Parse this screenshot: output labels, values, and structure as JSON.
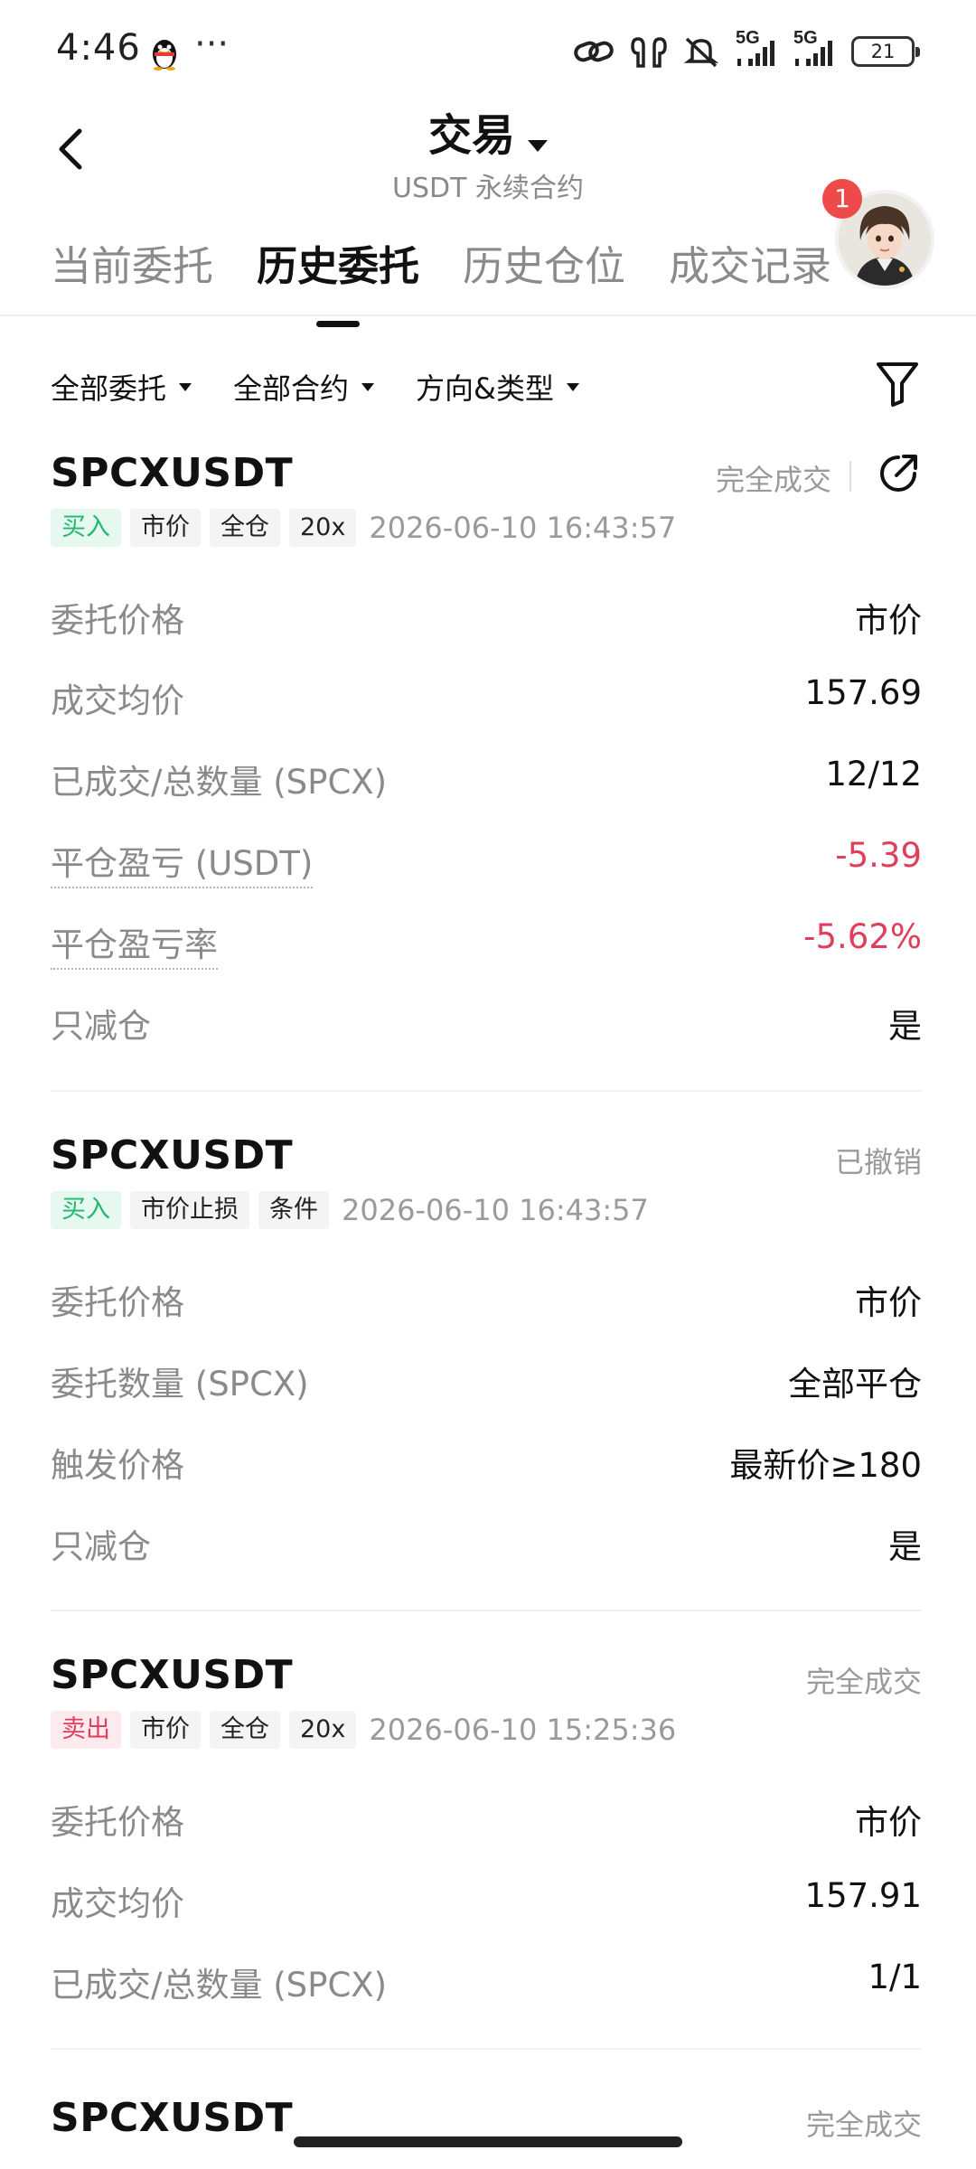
{
  "status_bar": {
    "time": "4:46",
    "more": "···",
    "signal1_label": "5G",
    "signal2_label": "5G",
    "battery": "21"
  },
  "header": {
    "title": "交易",
    "subtitle": "USDT 永续合约"
  },
  "tabs": [
    {
      "label": "当前委托",
      "active": false
    },
    {
      "label": "历史委托",
      "active": true
    },
    {
      "label": "历史仓位",
      "active": false
    },
    {
      "label": "成交记录",
      "active": false
    }
  ],
  "avatar": {
    "badge": "1"
  },
  "filters": [
    {
      "label": "全部委托"
    },
    {
      "label": "全部合约"
    },
    {
      "label": "方向&类型"
    }
  ],
  "orders": [
    {
      "symbol": "SPCXUSDT",
      "status": "完全成交",
      "tags": [
        {
          "text": "买入",
          "kind": "buy"
        },
        {
          "text": "市价"
        },
        {
          "text": "全仓"
        },
        {
          "text": "20x"
        }
      ],
      "time": "2026-06-10 16:43:57",
      "rows": [
        {
          "label": "委托价格",
          "value": "市价"
        },
        {
          "label": "成交均价",
          "value": "157.69"
        },
        {
          "label": "已成交/总数量 (SPCX)",
          "value": "12/12"
        },
        {
          "label": "平仓盈亏 (USDT)",
          "value": "-5.39"
        },
        {
          "label": "平仓盈亏率",
          "value": "-5.62%"
        },
        {
          "label": "只减仓",
          "value": "是"
        }
      ]
    },
    {
      "symbol": "SPCXUSDT",
      "status": "已撤销",
      "tags": [
        {
          "text": "买入",
          "kind": "buy"
        },
        {
          "text": "市价止损"
        },
        {
          "text": "条件"
        }
      ],
      "time": "2026-06-10 16:43:57",
      "rows": [
        {
          "label": "委托价格",
          "value": "市价"
        },
        {
          "label": "委托数量 (SPCX)",
          "value": "全部平仓"
        },
        {
          "label": "触发价格",
          "value": "最新价≥180"
        },
        {
          "label": "只减仓",
          "value": "是"
        }
      ]
    },
    {
      "symbol": "SPCXUSDT",
      "status": "完全成交",
      "tags": [
        {
          "text": "卖出",
          "kind": "sell"
        },
        {
          "text": "市价"
        },
        {
          "text": "全仓"
        },
        {
          "text": "20x"
        }
      ],
      "time": "2026-06-10 15:25:36",
      "rows": [
        {
          "label": "委托价格",
          "value": "市价"
        },
        {
          "label": "成交均价",
          "value": "157.91"
        },
        {
          "label": "已成交/总数量 (SPCX)",
          "value": "1/1"
        }
      ]
    },
    {
      "symbol": "SPCXUSDT",
      "status": "完全成交"
    }
  ],
  "colors": {
    "buy": "#23b870",
    "sell": "#e03f5c",
    "negative": "#e03f5c",
    "badge": "#ef4a4a"
  }
}
